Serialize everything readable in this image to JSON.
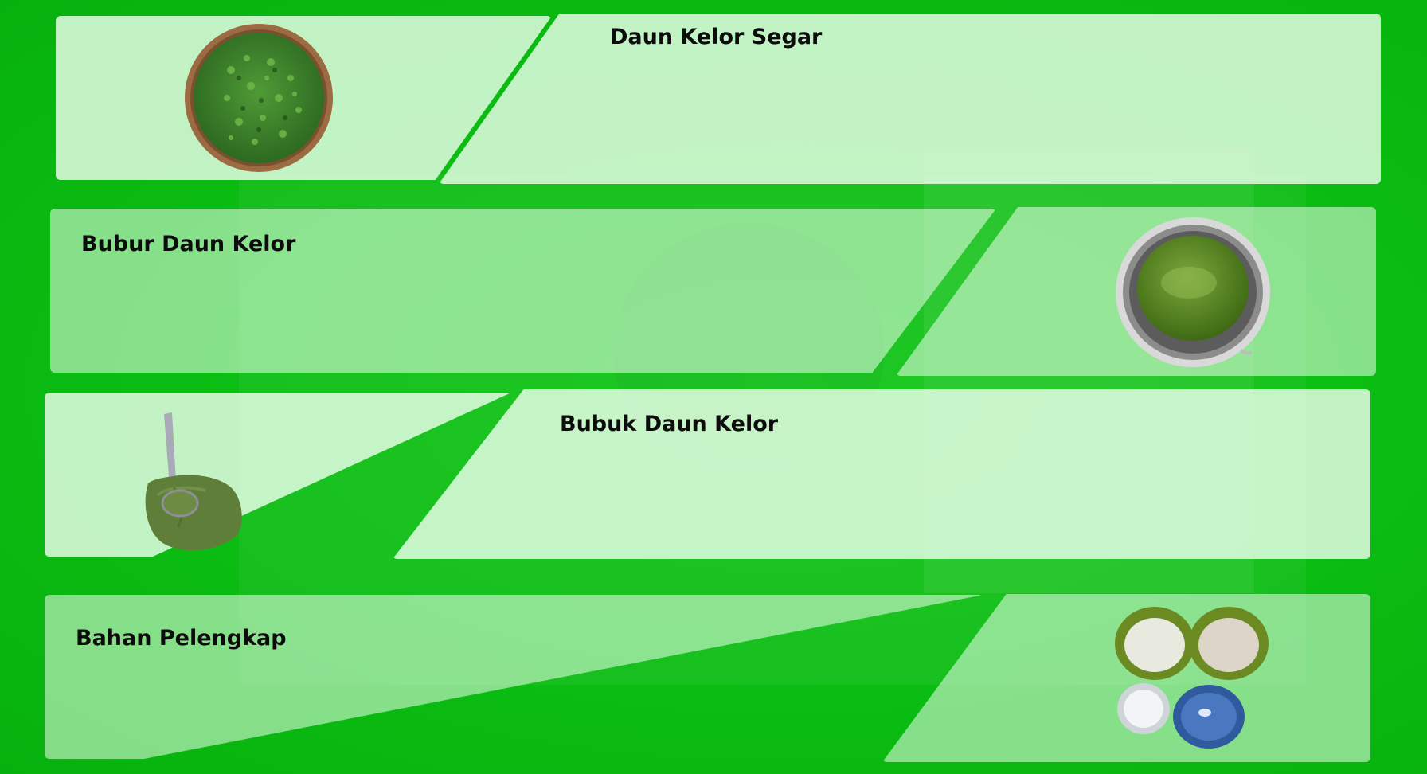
{
  "colors": {
    "background": "#0bbd12",
    "panel": "#dcf7dc",
    "panel_alt": "#a5e8a5",
    "title_text": "#0c0c0c"
  },
  "sections": [
    {
      "title": "Daun Kelor Segar",
      "image": "basket-of-fresh-moringa-leaves"
    },
    {
      "title": "Bubur Daun Kelor",
      "image": "pot-of-moringa-puree"
    },
    {
      "title": "Bubuk Daun Kelor",
      "image": "moringa-powder-with-scoop"
    },
    {
      "title": "Bahan Pelengkap",
      "image": "four-bowls-of-supplementary-ingredients"
    }
  ]
}
